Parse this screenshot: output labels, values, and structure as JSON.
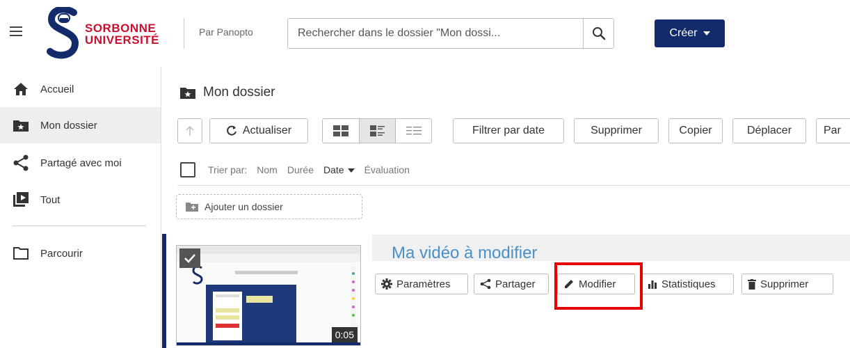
{
  "header": {
    "logo_line1": "SORBONNE",
    "logo_line2": "UNIVERSITÉ",
    "by_label": "Par Panopto",
    "search_placeholder": "Rechercher dans le dossier \"Mon dossi...",
    "create_label": "Créer"
  },
  "sidebar": {
    "items": [
      {
        "label": "Accueil",
        "icon": "home-icon"
      },
      {
        "label": "Mon dossier",
        "icon": "star-folder-icon"
      },
      {
        "label": "Partagé avec moi",
        "icon": "share-icon"
      },
      {
        "label": "Tout",
        "icon": "play-icon"
      },
      {
        "label": "Parcourir",
        "icon": "folder-icon"
      }
    ]
  },
  "main": {
    "folder_title": "Mon dossier",
    "toolbar": {
      "refresh": "Actualiser",
      "filter_date": "Filtrer par date",
      "delete": "Supprimer",
      "copy": "Copier",
      "move": "Déplacer",
      "share": "Par"
    },
    "sort": {
      "label": "Trier par:",
      "options": [
        "Nom",
        "Durée",
        "Date",
        "Évaluation"
      ],
      "active": "Date"
    },
    "add_folder": "Ajouter un dossier",
    "session": {
      "title": "Ma vidéo à modifier",
      "duration": "0:05",
      "actions": [
        "Paramètres",
        "Partager",
        "Modifier",
        "Statistiques",
        "Supprimer"
      ]
    }
  },
  "colors": {
    "brand_navy": "#132b6b",
    "brand_red": "#c8102e",
    "title_blue": "#4a90c8",
    "highlight_red": "#e60000"
  }
}
